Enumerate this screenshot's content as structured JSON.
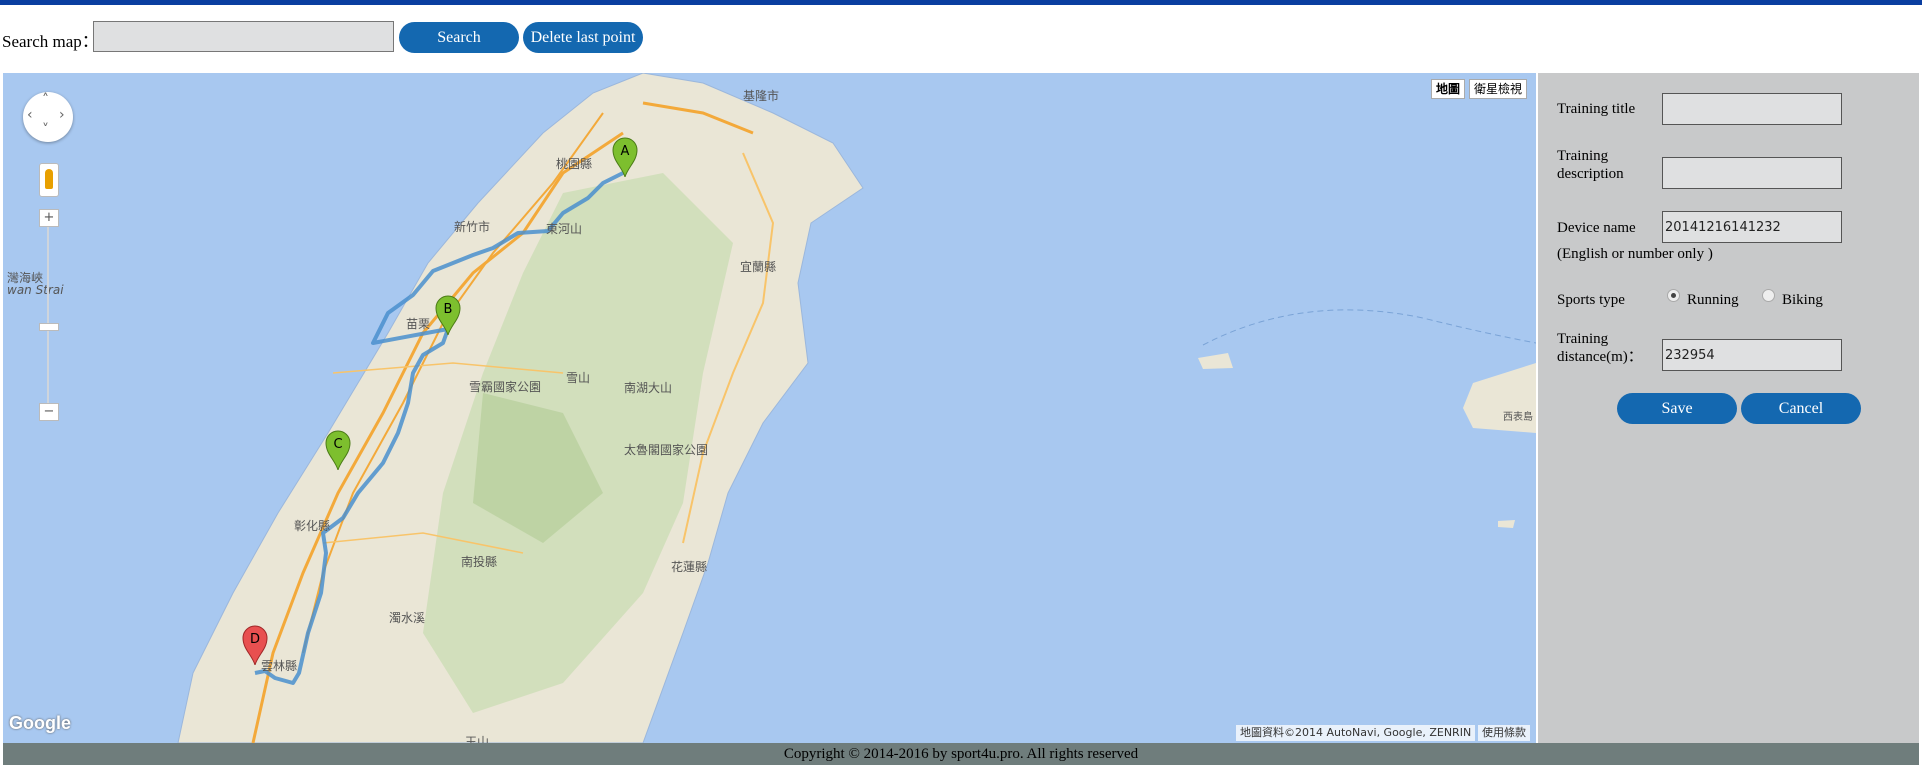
{
  "search": {
    "label": "Search map：",
    "input_value": "",
    "search_button": "Search",
    "delete_button": "Delete last point"
  },
  "map": {
    "type_buttons": [
      "地圖",
      "衛星檢視"
    ],
    "markers": [
      "A",
      "B",
      "C",
      "D"
    ],
    "places": {
      "taoyuan": "桃園縣",
      "hsinchu": "新竹市",
      "dongshan": "東河山",
      "miaoli": "苗栗",
      "yilan": "宜蘭縣",
      "shei_pa": "雪霸國家公園",
      "xueshan": "雪山",
      "nanhu": "南湖大山",
      "taroko": "太魯閣國家公園",
      "changhua": "彰化縣",
      "nantou": "南投縣",
      "hualien": "花蓮縣",
      "zhuoshui": "濁水溪",
      "yunlin": "雲林縣",
      "yushan": "玉山",
      "strait": "灣海峽",
      "strait_en": "wan Strai",
      "xibiao": "西表島",
      "keelung": "基隆市"
    },
    "google": "Google",
    "attribution": "地圖資料©2014 AutoNavi, Google, ZENRIN",
    "terms": "使用條款",
    "zoom_plus": "+",
    "zoom_minus": "−"
  },
  "form": {
    "title_label": "Training title",
    "title_value": "",
    "desc_label_1": "Training",
    "desc_label_2": "description",
    "desc_value": "",
    "device_label": "Device name",
    "device_value": "20141216141232",
    "device_hint": "(English or number only )",
    "sports_label": "Sports type",
    "sport_running": "Running",
    "sport_biking": "Biking",
    "sport_selected": "Running",
    "distance_label_1": "Training",
    "distance_label_2": "distance(m)：",
    "distance_value": "232954",
    "save": "Save",
    "cancel": "Cancel"
  },
  "footer": "Copyright © 2014-2016 by sport4u.pro. All rights reserved",
  "colors": {
    "accent": "#1468b0",
    "topbar": "#0a3ea0",
    "sea": "#a8c8f0",
    "land": "#eae6d6",
    "route": "#4a8fce",
    "marker_green": "#7dbf2e",
    "marker_red": "#e85050",
    "panel": "#c8c9ca",
    "footer": "#6f7d7c"
  }
}
